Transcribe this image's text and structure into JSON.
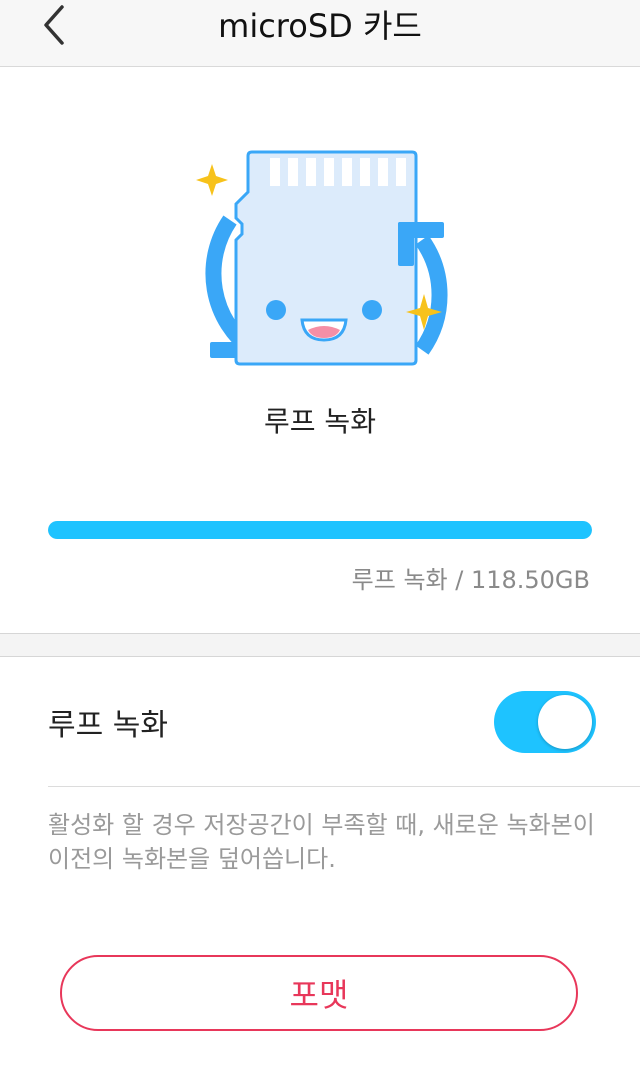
{
  "header": {
    "title": "microSD 카드",
    "back_icon": "chevron-left-icon"
  },
  "illustration": {
    "icon": "sd-card-loop-icon",
    "card_color": "#dcebfb",
    "arrow_color": "#3aa7f7",
    "sparkle_color": "#f7c21b"
  },
  "loop_title": "루프 녹화",
  "storage": {
    "used_fraction": 1.0,
    "label": "루프 녹화 / 118.50GB"
  },
  "setting": {
    "label": "루프 녹화",
    "enabled": true,
    "description": "활성화 할 경우 저장공간이 부족할 때, 새로운 녹화본이 이전의 녹화본을 덮어씁니다."
  },
  "format_button": "포맷",
  "colors": {
    "accent": "#1ec3ff",
    "danger": "#e8375a"
  }
}
